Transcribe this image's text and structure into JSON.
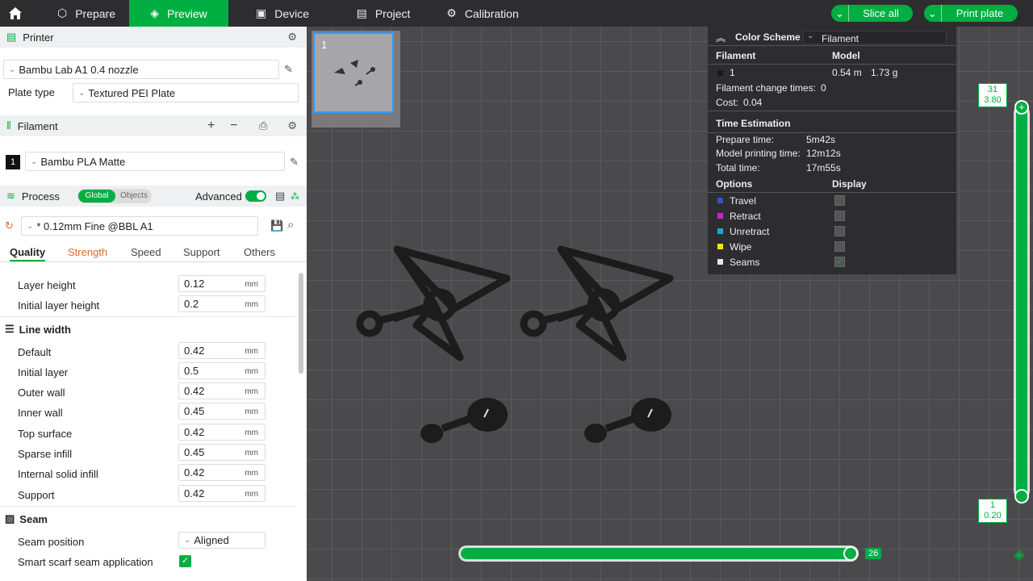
{
  "nav": {
    "tabs": [
      {
        "label": "Prepare"
      },
      {
        "label": "Preview"
      },
      {
        "label": "Device"
      },
      {
        "label": "Project"
      },
      {
        "label": "Calibration"
      }
    ],
    "slice_all": "Slice all",
    "print_plate": "Print plate"
  },
  "printer": {
    "title": "Printer",
    "model": "Bambu Lab A1 0.4 nozzle",
    "plate_type_label": "Plate type",
    "plate_type": "Textured PEI Plate"
  },
  "filament": {
    "title": "Filament",
    "slot": "1",
    "name": "Bambu PLA Matte"
  },
  "process": {
    "title": "Process",
    "global": "Global",
    "objects": "Objects",
    "advanced": "Advanced",
    "profile": "* 0.12mm Fine @BBL A1",
    "tabs": [
      "Quality",
      "Strength",
      "Speed",
      "Support",
      "Others"
    ]
  },
  "quality": {
    "layer_height": {
      "label": "Layer height",
      "value": "0.12",
      "unit": "mm"
    },
    "initial_layer_height": {
      "label": "Initial layer height",
      "value": "0.2",
      "unit": "mm"
    },
    "line_width_title": "Line width",
    "line_width": [
      {
        "label": "Default",
        "value": "0.42",
        "unit": "mm"
      },
      {
        "label": "Initial layer",
        "value": "0.5",
        "unit": "mm"
      },
      {
        "label": "Outer wall",
        "value": "0.42",
        "unit": "mm"
      },
      {
        "label": "Inner wall",
        "value": "0.45",
        "unit": "mm"
      },
      {
        "label": "Top surface",
        "value": "0.42",
        "unit": "mm"
      },
      {
        "label": "Sparse infill",
        "value": "0.45",
        "unit": "mm"
      },
      {
        "label": "Internal solid infill",
        "value": "0.42",
        "unit": "mm"
      },
      {
        "label": "Support",
        "value": "0.42",
        "unit": "mm"
      }
    ],
    "seam_title": "Seam",
    "seam_position_label": "Seam position",
    "seam_position": "Aligned",
    "smart_scarf_label": "Smart scarf seam application"
  },
  "plate": {
    "number": "1"
  },
  "legend": {
    "color_scheme_label": "Color Scheme",
    "color_scheme_value": "Filament",
    "filament_header": "Filament",
    "model_header": "Model",
    "filament_id": "1",
    "length": "0.54 m",
    "weight": "1.73 g",
    "change_times_label": "Filament change times:",
    "change_times": "0",
    "cost_label": "Cost:",
    "cost": "0.04",
    "time_estimation": "Time Estimation",
    "prepare_time_label": "Prepare time:",
    "prepare_time": "5m42s",
    "model_time_label": "Model printing time:",
    "model_time": "12m12s",
    "total_time_label": "Total time:",
    "total_time": "17m55s",
    "options_header": "Options",
    "display_header": "Display",
    "options": [
      {
        "label": "Travel",
        "color": "#3a4ecf"
      },
      {
        "label": "Retract",
        "color": "#d11fcf"
      },
      {
        "label": "Unretract",
        "color": "#19a8d6"
      },
      {
        "label": "Wipe",
        "color": "#f5e60a"
      },
      {
        "label": "Seams",
        "color": "#e8e8e8"
      }
    ]
  },
  "layers": {
    "top_layer": "31",
    "top_height": "3.80",
    "bottom_layer": "1",
    "bottom_height": "0.20",
    "horizontal_value": "26"
  },
  "colors": {
    "accent": "#00ae42"
  }
}
